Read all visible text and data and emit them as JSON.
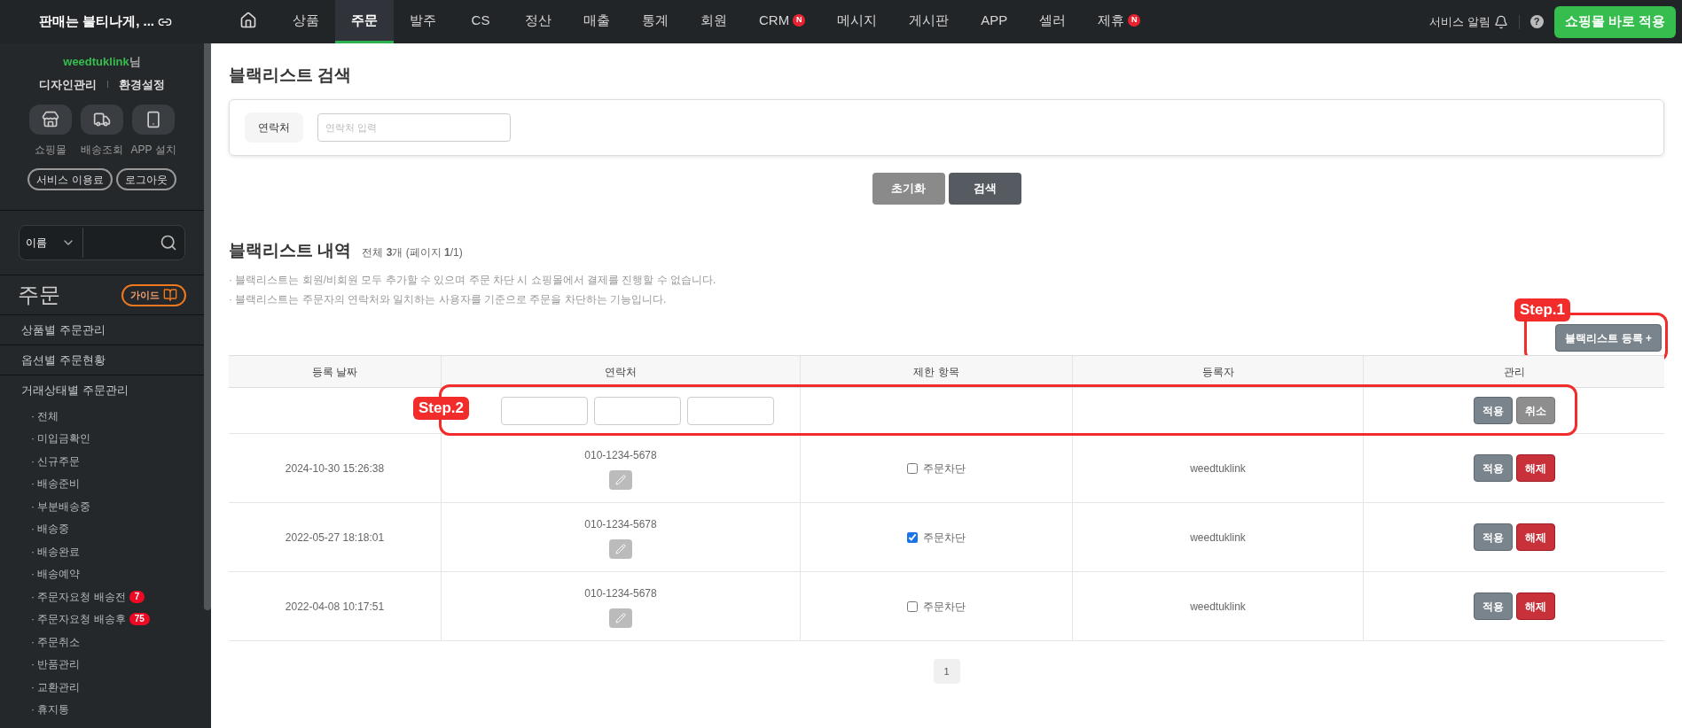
{
  "brand": {
    "title": "판매는 불티나게, ..."
  },
  "nav": [
    {
      "kind": "icon",
      "selected": false
    },
    {
      "kind": "text",
      "label": "상품",
      "selected": false
    },
    {
      "kind": "text",
      "label": "주문",
      "selected": true
    },
    {
      "kind": "text",
      "label": "발주",
      "selected": false
    },
    {
      "kind": "text",
      "label": "CS",
      "selected": false
    },
    {
      "kind": "text",
      "label": "정산",
      "selected": false
    },
    {
      "kind": "text",
      "label": "매출",
      "selected": false
    },
    {
      "kind": "text",
      "label": "통계",
      "selected": false
    },
    {
      "kind": "text",
      "label": "회원",
      "selected": false
    },
    {
      "kind": "text",
      "label": "CRM",
      "badge": "N",
      "selected": false
    },
    {
      "kind": "text",
      "label": "메시지",
      "selected": false
    },
    {
      "kind": "text",
      "label": "게시판",
      "selected": false
    },
    {
      "kind": "text",
      "label": "APP",
      "selected": false
    },
    {
      "kind": "text",
      "label": "셀러",
      "selected": false
    },
    {
      "kind": "text",
      "label": "제휴",
      "badge": "N",
      "selected": false
    }
  ],
  "topbar_right": {
    "alerts": "서비스 알림",
    "help": "?",
    "apply_button": "쇼핑몰 바로 적용"
  },
  "sidebar": {
    "user": "weedtuklink",
    "user_suffix": "님",
    "links": [
      "디자인관리",
      "환경설정"
    ],
    "shortcuts": [
      {
        "kind": "store",
        "label": "쇼핑몰"
      },
      {
        "kind": "truck",
        "label": "배송조회"
      },
      {
        "kind": "phone",
        "label": "APP 설치"
      }
    ],
    "pill_buttons": [
      "서비스 이용료",
      "로그아웃"
    ],
    "search": {
      "select": "이름"
    },
    "section": {
      "title": "주문",
      "guide": "가이드"
    },
    "items": [
      {
        "label": "상품별 주문관리"
      },
      {
        "label": "옵션별 주문현황"
      },
      {
        "label": "거래상태별 주문관리",
        "children": [
          {
            "label": "· 전체"
          },
          {
            "label": "· 미입금확인"
          },
          {
            "label": "· 신규주문"
          },
          {
            "label": "· 배송준비"
          },
          {
            "label": "· 부분배송중"
          },
          {
            "label": "· 배송중"
          },
          {
            "label": "· 배송완료"
          },
          {
            "label": "· 배송예약"
          },
          {
            "label": "· 주문자요청 배송전",
            "badge": "7"
          },
          {
            "label": "· 주문자요청 배송후",
            "badge": "75"
          },
          {
            "label": "· 주문취소"
          },
          {
            "label": "· 반품관리"
          },
          {
            "label": "· 교환관리"
          },
          {
            "label": "· 휴지통"
          }
        ]
      }
    ]
  },
  "search_section": {
    "title": "블랙리스트 검색",
    "field_label": "연락처",
    "placeholder": "연락처 입력",
    "buttons": [
      {
        "kind": "reset",
        "label": "초기화"
      },
      {
        "kind": "search",
        "label": "검색"
      }
    ]
  },
  "list_section": {
    "title": "블랙리스트 내역",
    "summary": "전체 **3**개 (페이지 **1**/1)",
    "notes": [
      "· 블랙리스트는 회원/비회원 모두 추가할 수 있으며 주문 차단 시 쇼핑몰에서 결제를 진행할 수 없습니다.",
      "· 블랙리스트는 주문자의 연락처와 일치하는 사용자를 기준으로 주문을 차단하는 기능입니다."
    ],
    "register_button": "블랙리스트 등록 +",
    "step1": "Step.1",
    "step2": "Step.2"
  },
  "table": {
    "columns": [
      "등록 날짜",
      "연락처",
      "제한 항목",
      "등록자",
      "관리"
    ],
    "new_row": {
      "apply": "적용",
      "cancel": "취소"
    },
    "rows": [
      {
        "date": "2024-10-30 15:26:38",
        "phone": "010-1234-5678",
        "restriction": "주문차단",
        "checked": false,
        "registrant": "weedtuklink",
        "apply": "적용",
        "release": "해제"
      },
      {
        "date": "2022-05-27 18:18:01",
        "phone": "010-1234-5678",
        "restriction": "주문차단",
        "checked": true,
        "registrant": "weedtuklink",
        "apply": "적용",
        "release": "해제"
      },
      {
        "date": "2022-04-08 10:17:51",
        "phone": "010-1234-5678",
        "restriction": "주문차단",
        "checked": false,
        "registrant": "weedtuklink",
        "apply": "적용",
        "release": "해제"
      }
    ]
  },
  "pagination": [
    {
      "label": "1",
      "selected": true
    }
  ]
}
